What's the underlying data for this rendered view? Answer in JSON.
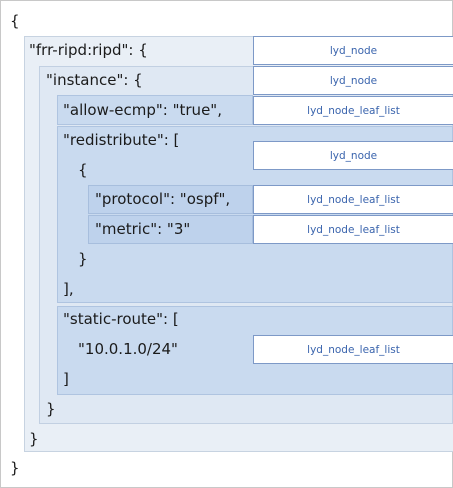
{
  "json_lines": {
    "open_root": "{",
    "ripd_key": "\"frr-ripd:ripd\": {",
    "instance_key": "\"instance\": {",
    "allow_ecmp": "\"allow-ecmp\": \"true\",",
    "redistribute_key": "\"redistribute\": [",
    "redis_open": "{",
    "protocol": "\"protocol\": \"ospf\",",
    "metric": "\"metric\": \"3\"",
    "redis_close": "}",
    "redistribute_close": "],",
    "static_route_key": "\"static-route\": [",
    "static_route_value": "\"10.0.1.0/24\"",
    "static_route_close": "]",
    "instance_close": "}",
    "ripd_close": "}",
    "close_root": "}"
  },
  "type_labels": {
    "ripd": "lyd_node",
    "instance": "lyd_node",
    "allow_ecmp": "lyd_node_leaf_list",
    "redistribute_entry": "lyd_node",
    "protocol": "lyd_node_leaf_list",
    "metric": "lyd_node_leaf_list",
    "static_route": "lyd_node_leaf_list"
  }
}
